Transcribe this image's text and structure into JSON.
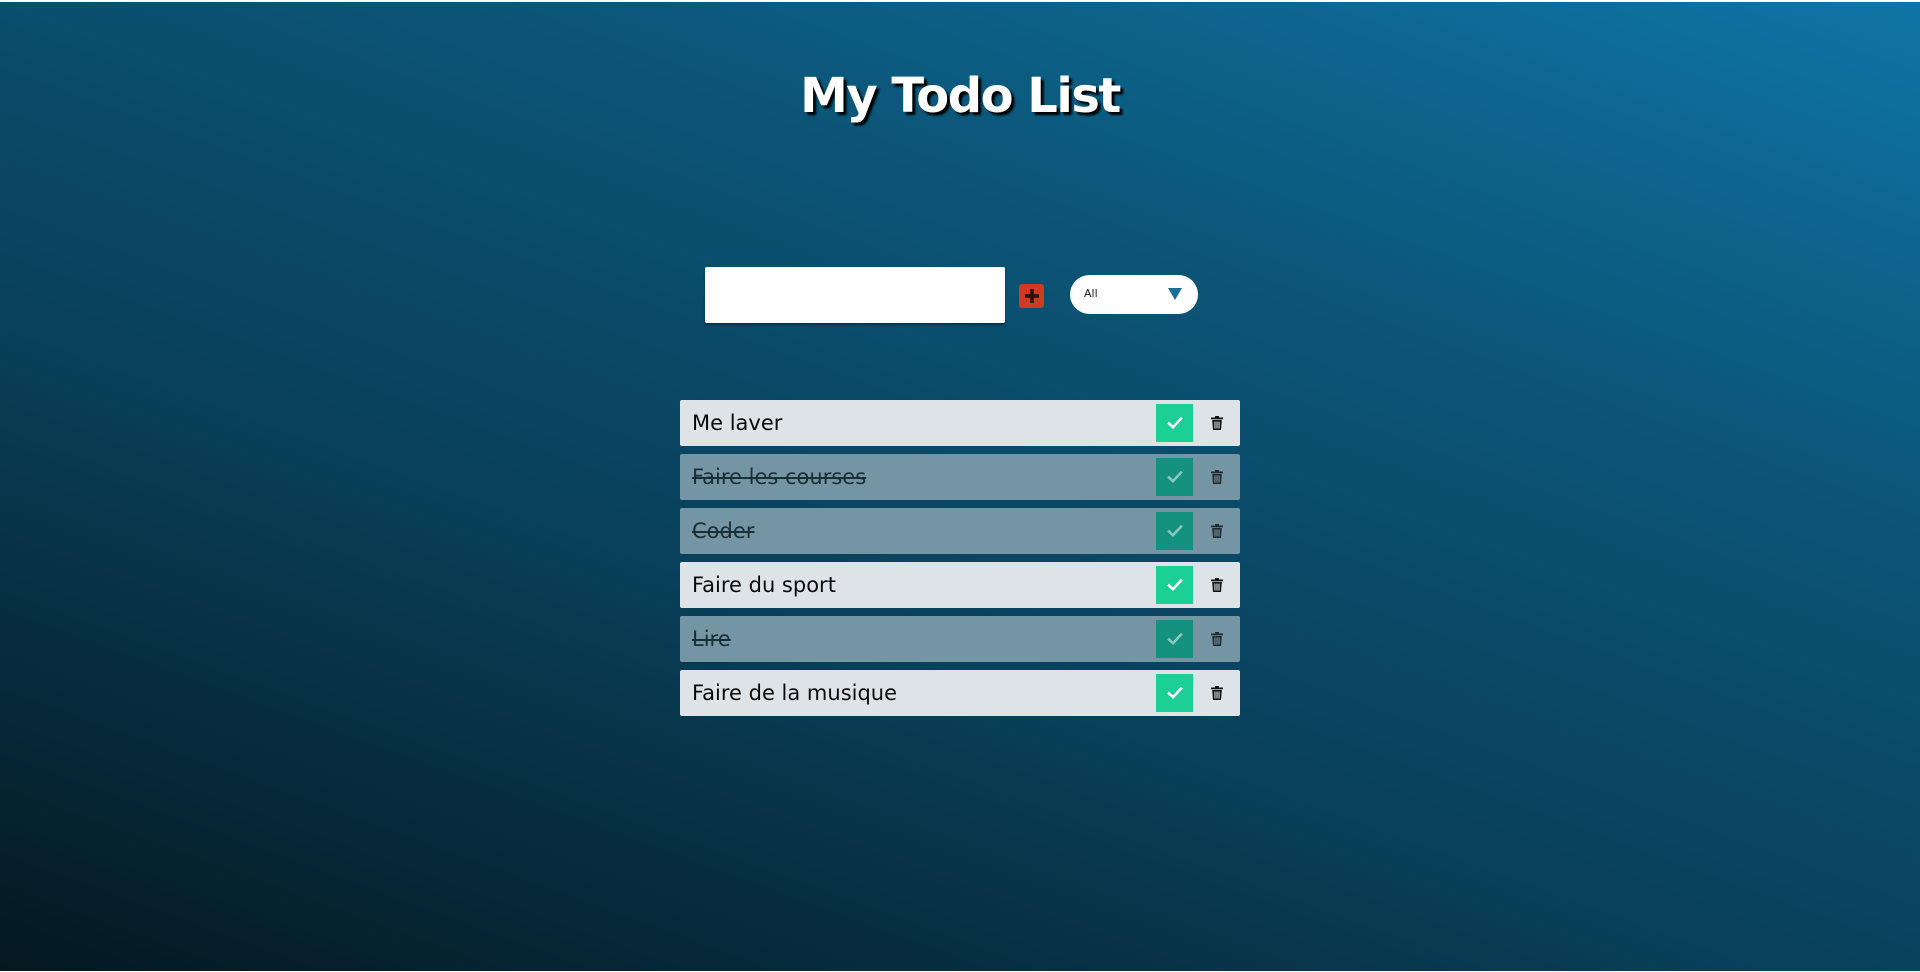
{
  "app": {
    "title": "My Todo List"
  },
  "form": {
    "input_value": "",
    "add_icon": "plus-square-icon",
    "filter_selected": "All",
    "filter_icon": "triangle-down-icon"
  },
  "colors": {
    "add_button": "#d03a20",
    "complete_button": "#1ccf95",
    "complete_button_done": "#15917f",
    "item_background": "#dde3e7",
    "item_background_done": "#7495a3",
    "filter_arrow": "#1a6e9a"
  },
  "todos": [
    {
      "text": "Me laver",
      "completed": false,
      "complete_icon": "check-icon",
      "delete_icon": "trash-icon"
    },
    {
      "text": "Faire les courses",
      "completed": true,
      "complete_icon": "check-icon",
      "delete_icon": "trash-icon"
    },
    {
      "text": "Coder",
      "completed": true,
      "complete_icon": "check-icon",
      "delete_icon": "trash-icon"
    },
    {
      "text": "Faire du sport",
      "completed": false,
      "complete_icon": "check-icon",
      "delete_icon": "trash-icon"
    },
    {
      "text": "Lire",
      "completed": true,
      "complete_icon": "check-icon",
      "delete_icon": "trash-icon"
    },
    {
      "text": "Faire de la musique",
      "completed": false,
      "complete_icon": "check-icon",
      "delete_icon": "trash-icon"
    }
  ]
}
